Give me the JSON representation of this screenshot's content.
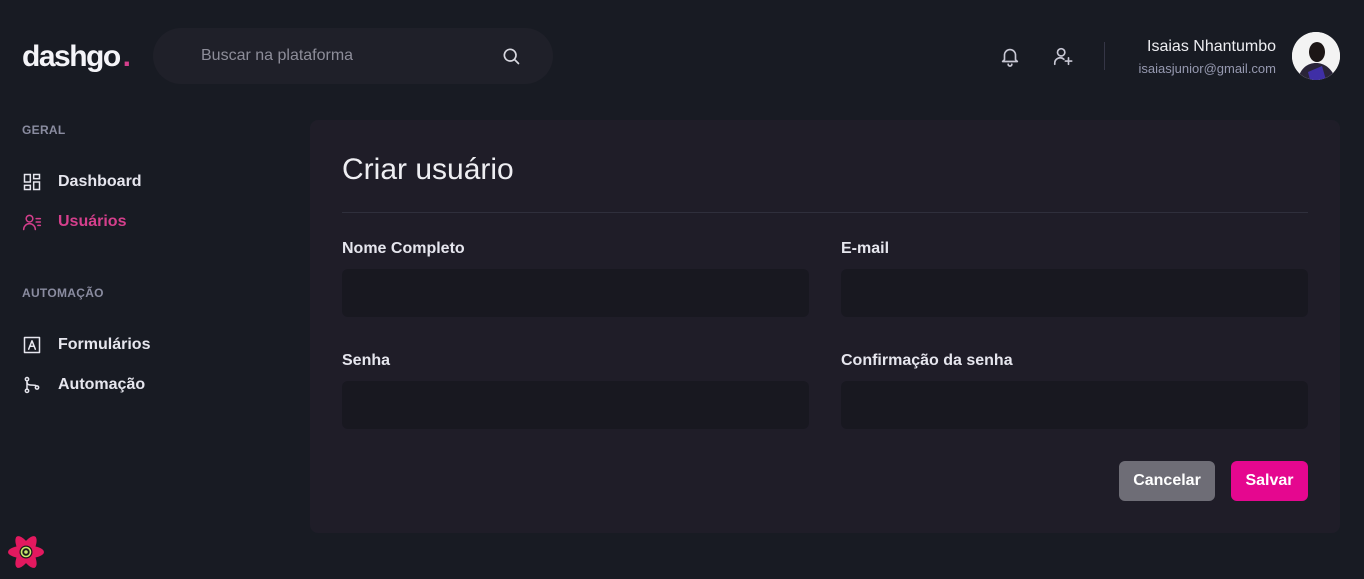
{
  "header": {
    "logo_text": "dashgo",
    "logo_dot": ".",
    "search_placeholder": "Buscar na plataforma",
    "user": {
      "name": "Isaias Nhantumbo",
      "email": "isaiasjunior@gmail.com"
    }
  },
  "sidebar": {
    "sections": [
      {
        "title": "GERAL",
        "items": [
          {
            "label": "Dashboard"
          },
          {
            "label": "Usuários",
            "active": true
          }
        ]
      },
      {
        "title": "AUTOMAÇÃO",
        "items": [
          {
            "label": "Formulários"
          },
          {
            "label": "Automação"
          }
        ]
      }
    ]
  },
  "form": {
    "title": "Criar usuário",
    "fields": {
      "name": {
        "label": "Nome Completo",
        "value": ""
      },
      "email": {
        "label": "E-mail",
        "value": ""
      },
      "password": {
        "label": "Senha",
        "value": ""
      },
      "password_confirmation": {
        "label": "Confirmação da senha",
        "value": ""
      }
    },
    "buttons": {
      "cancel": "Cancelar",
      "save": "Salvar"
    }
  },
  "colors": {
    "background": "#181b23",
    "accent": "#d53f8c",
    "save_button": "#e5078f",
    "cancel_button": "#6e6d76"
  },
  "icons": [
    "search-icon",
    "bell-icon",
    "user-plus-icon",
    "dashboard-icon",
    "users-icon",
    "form-icon",
    "git-branch-icon",
    "react-icon"
  ]
}
